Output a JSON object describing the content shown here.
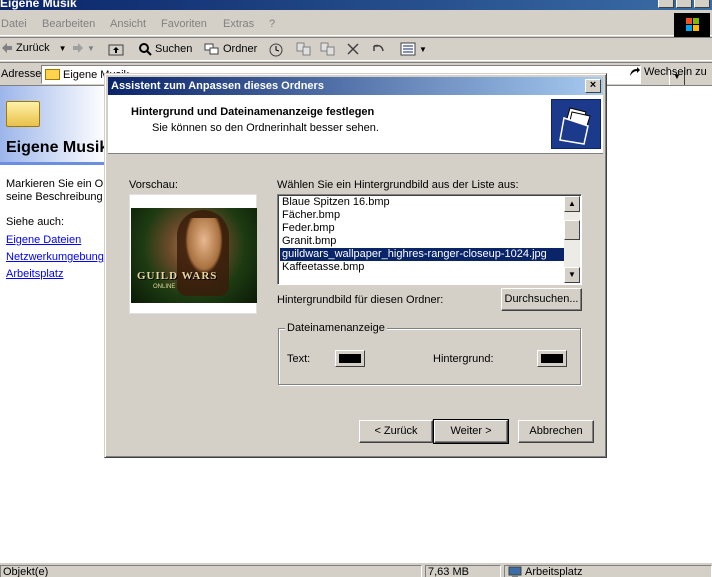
{
  "window": {
    "title": "Eigene Musik",
    "menu": [
      "Datei",
      "Bearbeiten",
      "Ansicht",
      "Favoriten",
      "Extras",
      "?"
    ]
  },
  "toolbar": {
    "back": "Zurück",
    "search": "Suchen",
    "folders": "Ordner"
  },
  "addressbar": {
    "label": "Adresse",
    "value": "Eigene Musik",
    "go": "Wechseln zu"
  },
  "sidepanel": {
    "title": "Eigene Musik",
    "desc_line1": "Markieren Sie ein Objekt, um",
    "desc_line2": "seine Beschreibung anzuzeigen.",
    "see_also": "Siehe auch:",
    "links": [
      "Eigene Dateien",
      "Netzwerkumgebung",
      "Arbeitsplatz"
    ]
  },
  "statusbar": {
    "objects": "Objekt(e)",
    "size": "7,63 MB",
    "location": "Arbeitsplatz"
  },
  "dialog": {
    "title": "Assistent zum Anpassen dieses Ordners",
    "heading": "Hintergrund und Dateinamenanzeige festlegen",
    "subheading": "Sie können so den Ordnerinhalt besser sehen.",
    "preview_label": "Vorschau:",
    "preview_text_main": "GUILD WARS",
    "preview_text_sub": "ONLINE",
    "list_label": "Wählen Sie ein Hintergrundbild aus der Liste aus:",
    "list_items": [
      "Blaue Spitzen 16.bmp",
      "Fächer.bmp",
      "Feder.bmp",
      "Granit.bmp",
      "guildwars_wallpaper_highres-ranger-closeup-1024.jpg",
      "Kaffeetasse.bmp"
    ],
    "selected_index": 4,
    "bg_label": "Hintergrundbild für diesen Ordner:",
    "browse_button": "Durchsuchen...",
    "group_label": "Dateinamenanzeige",
    "text_label": "Text:",
    "background_label": "Hintergrund:",
    "text_color": "#000000",
    "background_color": "#000000",
    "back_button": "< Zurück",
    "next_button": "Weiter >",
    "cancel_button": "Abbrechen"
  }
}
